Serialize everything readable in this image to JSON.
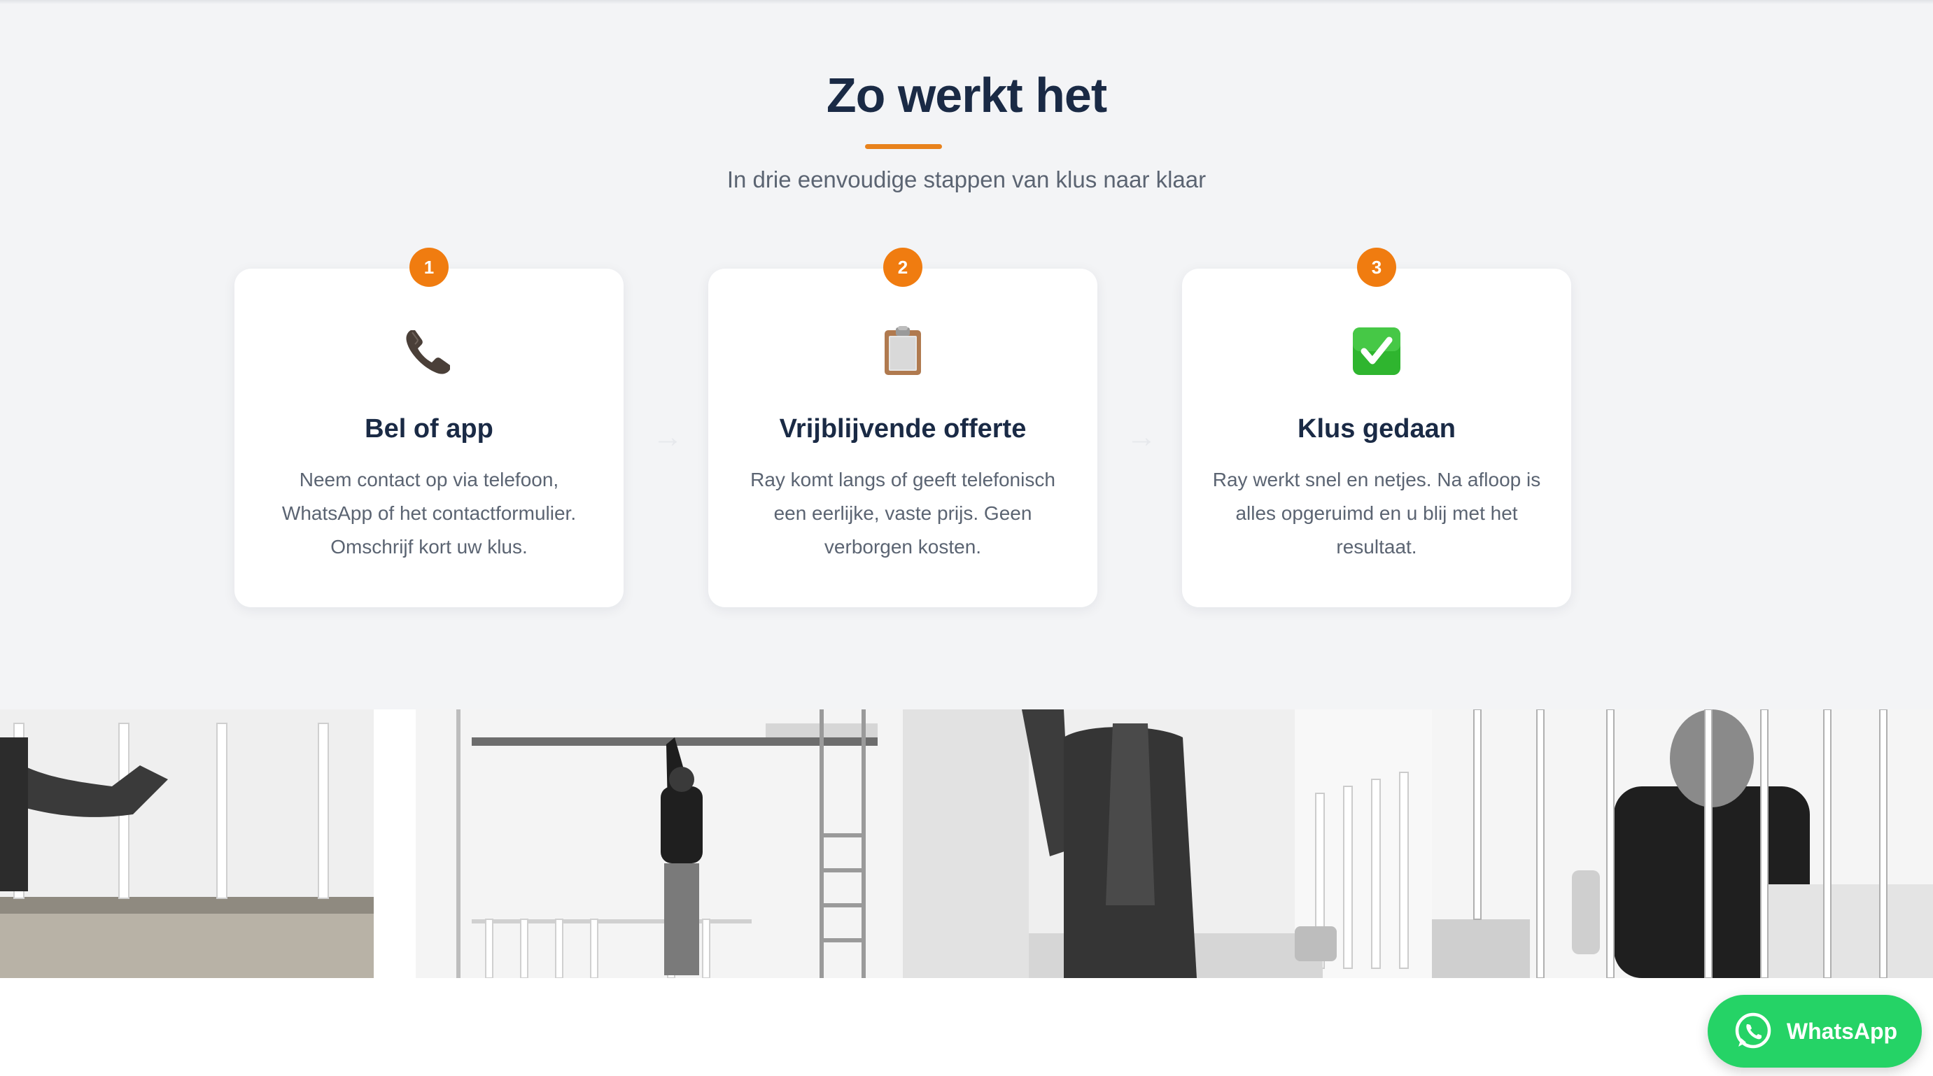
{
  "section": {
    "title": "Zo werkt het",
    "subtitle": "In drie eenvoudige stappen van klus naar klaar"
  },
  "steps": [
    {
      "number": "1",
      "icon": "phone-icon",
      "title": "Bel of app",
      "description": "Neem contact op via telefoon, WhatsApp of het contactformulier. Omschrijf kort uw klus."
    },
    {
      "number": "2",
      "icon": "clipboard-icon",
      "title": "Vrijblijvende offerte",
      "description": "Ray komt langs of geeft telefonisch een eerlijke, vaste prijs. Geen verborgen kosten."
    },
    {
      "number": "3",
      "icon": "check-mark-icon",
      "title": "Klus gedaan",
      "description": "Ray werkt snel en netjes. Na afloop is alles opgeruimd en u blij met het resultaat."
    }
  ],
  "whatsapp": {
    "label": "WhatsApp"
  },
  "colors": {
    "accent": "#f07c10",
    "heading": "#1a2a45",
    "whatsapp": "#25d366",
    "background": "#f3f4f6"
  }
}
